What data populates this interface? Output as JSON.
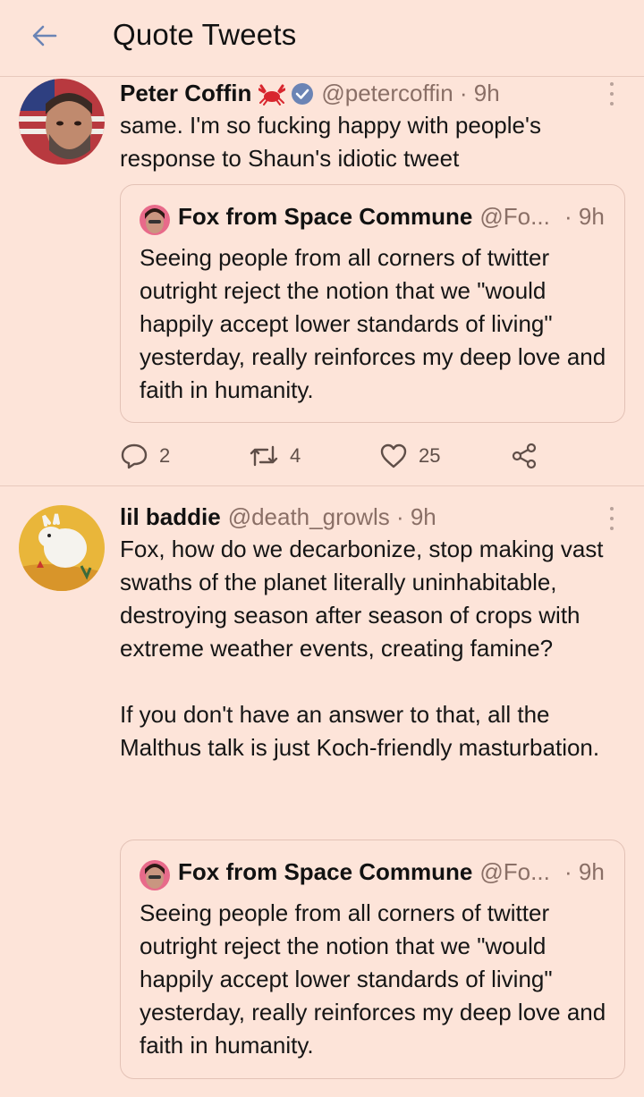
{
  "header": {
    "title": "Quote Tweets"
  },
  "tweets": [
    {
      "name": "Peter Coffin",
      "handle": "@petercoffin · 9h",
      "text": "same. I'm so fucking happy with people's response to Shaun's idiotic tweet",
      "quote": {
        "name": "Fox from Space Commune",
        "handle": "@Fo...",
        "time": "· 9h",
        "text": "Seeing people from all corners of twitter outright reject the notion that we \"would happily accept lower standards of living\" yesterday, really reinforces my deep love and faith in humanity."
      },
      "actions": {
        "replies": "2",
        "retweets": "4",
        "likes": "25"
      }
    },
    {
      "name": "lil baddie",
      "handle": "@death_growls · 9h",
      "text": "Fox, how do we decarbonize, stop making vast swaths of the planet literally uninhabitable, destroying season after season of crops with extreme weather events, creating famine?\n\nIf you don't have an answer to that, all the Malthus talk is just Koch-friendly masturbation.",
      "quote": {
        "name": "Fox from Space Commune",
        "handle": "@Fo...",
        "time": "· 9h",
        "text": "Seeing people from all corners of twitter outright reject the notion that we \"would happily accept lower standards of living\" yesterday, really reinforces my deep love and faith in humanity."
      }
    }
  ],
  "colors": {
    "background": "#fde4d9",
    "accent": "#6b84b5",
    "divider": "#e8c9bd"
  },
  "icons": [
    "back-arrow-icon",
    "crab-emoji-icon",
    "verified-badge-icon",
    "reply-icon",
    "retweet-icon",
    "like-icon",
    "share-icon",
    "more-icon"
  ]
}
